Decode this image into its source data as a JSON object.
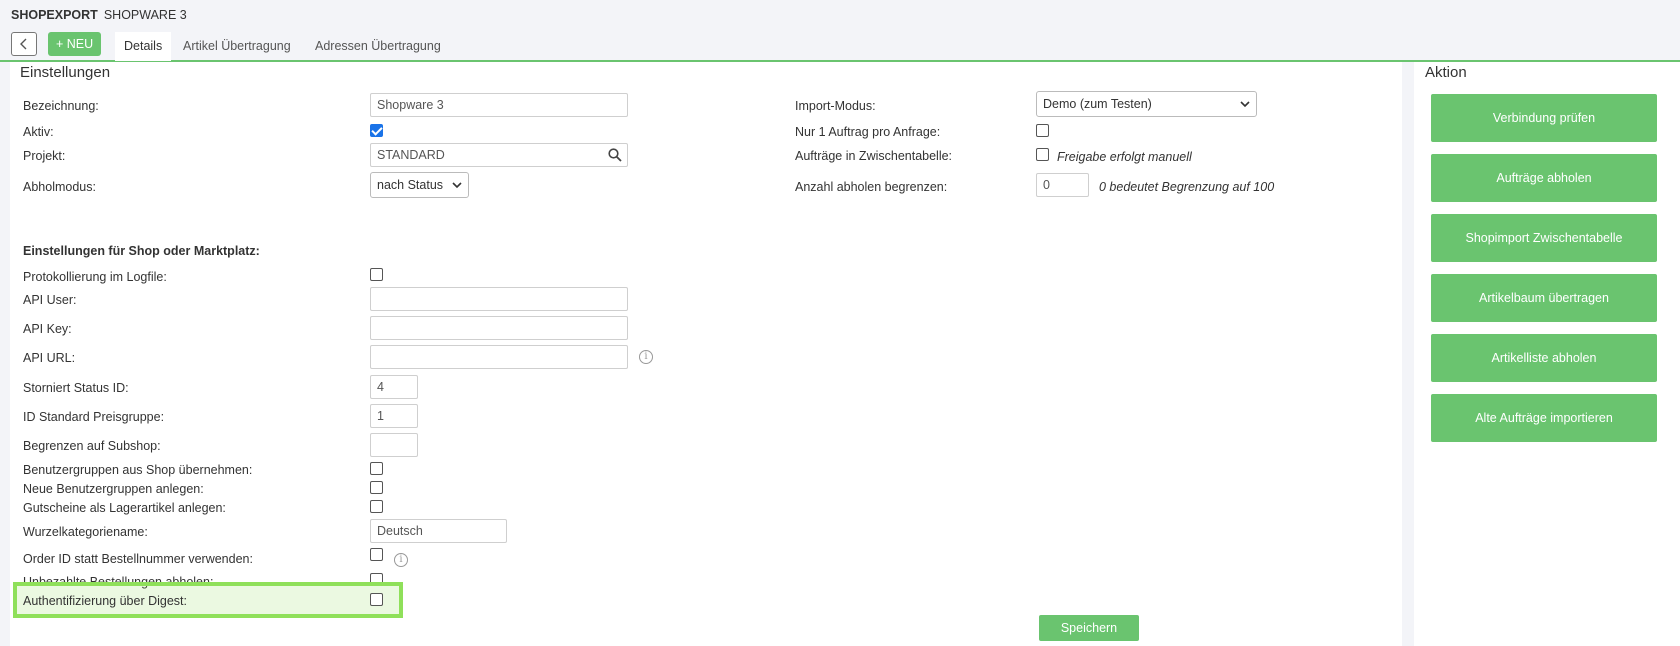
{
  "header": {
    "brand": "SHOPEXPORT",
    "subtitle": "SHOPWARE 3",
    "new_button": "+ NEU",
    "tabs": [
      "Details",
      "Artikel Übertragung",
      "Adressen Übertragung"
    ]
  },
  "main": {
    "title": "Einstellungen",
    "fields": {
      "bezeichnung": {
        "label": "Bezeichnung:",
        "value": "Shopware 3"
      },
      "aktiv": {
        "label": "Aktiv:",
        "checked": true
      },
      "projekt": {
        "label": "Projekt:",
        "value": "STANDARD"
      },
      "abholmodus": {
        "label": "Abholmodus:",
        "value": "nach Status"
      },
      "import_modus": {
        "label": "Import-Modus:",
        "value": "Demo (zum Testen)"
      },
      "nur1": {
        "label": "Nur 1 Auftrag pro Anfrage:"
      },
      "zwischentabelle": {
        "label": "Aufträge in Zwischentabelle:",
        "note": "Freigabe erfolgt manuell"
      },
      "anzahl": {
        "label": "Anzahl abholen begrenzen:",
        "value": "0",
        "note": "0 bedeutet Begrenzung auf 100"
      }
    },
    "shop_section": {
      "heading": "Einstellungen für Shop oder Marktplatz:",
      "protokollierung": "Protokollierung im Logfile:",
      "api_user": "API User:",
      "api_key": "API Key:",
      "api_url": "API URL:",
      "storniert": {
        "label": "Storniert Status ID:",
        "value": "4"
      },
      "preisgruppe": {
        "label": "ID Standard Preisgruppe:",
        "value": "1"
      },
      "subshop": "Begrenzen auf Subshop:",
      "benutzergruppen": "Benutzergruppen aus Shop übernehmen:",
      "neue_benutzergruppen": "Neue Benutzergruppen anlegen:",
      "gutscheine": "Gutscheine als Lagerartikel anlegen:",
      "wurzel": {
        "label": "Wurzelkategoriename:",
        "value": "Deutsch"
      },
      "order_id": "Order ID statt Bestellnummer verwenden:",
      "unbezahlte": "Unbezahlte Bestellungen abholen:",
      "digest": "Authentifizierung über Digest:"
    },
    "save_button": "Speichern"
  },
  "sidebar": {
    "title": "Aktion",
    "actions": [
      "Verbindung prüfen",
      "Aufträge abholen",
      "Shopimport Zwischentabelle",
      "Artikelbaum übertragen",
      "Artikelliste abholen",
      "Alte Aufträge importieren"
    ]
  },
  "colors": {
    "accent": "#6ac46f",
    "highlight": "#8fe05a",
    "checkbox": "#1a73e8"
  },
  "icons": {
    "back": "chevron-left-icon",
    "search": "search-icon",
    "info": "info-icon",
    "dropdown": "chevron-down-icon"
  }
}
